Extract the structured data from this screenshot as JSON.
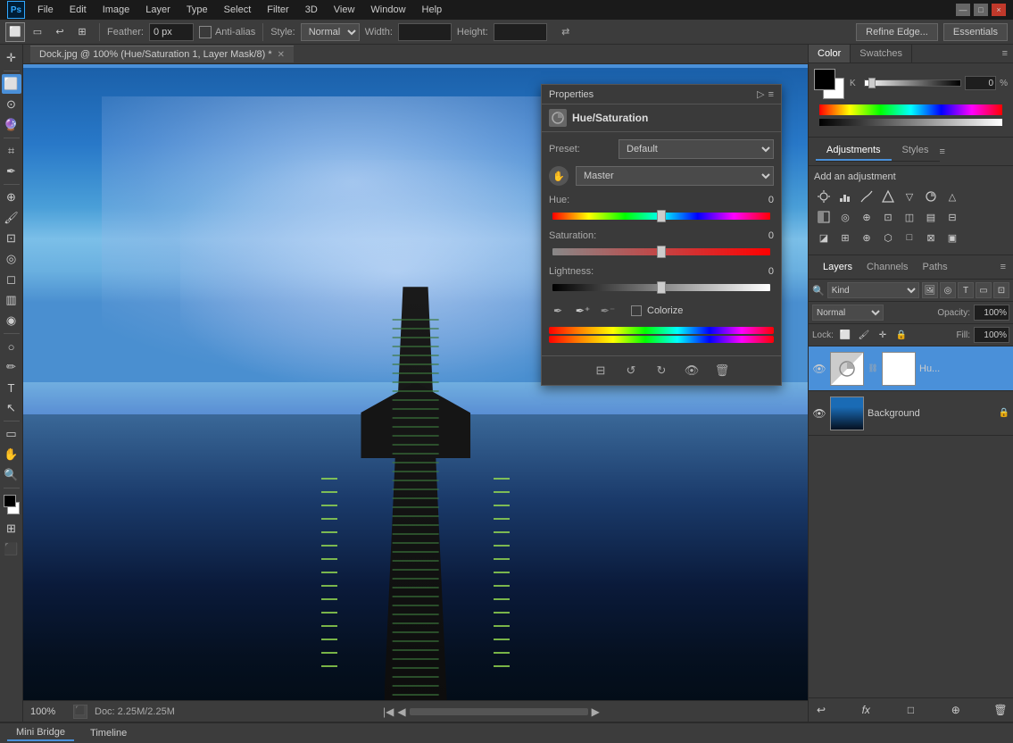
{
  "titlebar": {
    "logo": "Ps",
    "menu_items": [
      "File",
      "Edit",
      "Image",
      "Layer",
      "Type",
      "Select",
      "Filter",
      "3D",
      "View",
      "Window",
      "Help"
    ],
    "win_buttons": [
      "—",
      "□",
      "×"
    ]
  },
  "options_bar": {
    "feather_label": "Feather:",
    "feather_value": "0 px",
    "anti_alias": "Anti-alias",
    "style_label": "Style:",
    "style_value": "Normal",
    "width_label": "Width:",
    "height_label": "Height:",
    "refine_edge": "Refine Edge...",
    "essentials": "Essentials"
  },
  "canvas": {
    "tab_title": "Dock.jpg @ 100% (Hue/Saturation 1, Layer Mask/8) *"
  },
  "properties_panel": {
    "title": "Properties",
    "section_title": "Hue/Saturation",
    "preset_label": "Preset:",
    "preset_value": "Default",
    "channel_label": "Master",
    "hue_label": "Hue:",
    "hue_value": "0",
    "saturation_label": "Saturation:",
    "saturation_value": "0",
    "lightness_label": "Lightness:",
    "lightness_value": "0",
    "colorize_label": "Colorize"
  },
  "color_panel": {
    "color_tab": "Color",
    "swatches_tab": "Swatches",
    "channel_label": "K",
    "channel_value": "0",
    "pct": "%"
  },
  "adjustments_panel": {
    "title": "Adjustments",
    "styles_tab": "Styles",
    "add_adjustment": "Add an adjustment",
    "adj_icons": [
      "☀",
      "▦",
      "◐",
      "◭",
      "▽",
      "△",
      "◈",
      "⊞",
      "≈",
      "⊕",
      "⊡",
      "◫",
      "▤",
      "⊟",
      "◪",
      "⊞",
      "⊕",
      "⬡",
      "□",
      "⊠",
      "▣"
    ]
  },
  "layers_panel": {
    "layers_tab": "Layers",
    "channels_tab": "Channels",
    "paths_tab": "Paths",
    "kind_label": "Kind",
    "blend_mode": "Normal",
    "opacity_label": "Opacity:",
    "opacity_value": "100%",
    "lock_label": "Lock:",
    "fill_label": "Fill:",
    "fill_value": "100%",
    "layers": [
      {
        "name": "Hu...",
        "visible": true,
        "has_mask": true,
        "type": "adjustment"
      },
      {
        "name": "Background",
        "visible": true,
        "has_mask": false,
        "locked": true,
        "type": "image"
      }
    ],
    "bottom_icons": [
      "↩",
      "fx",
      "□",
      "⊕",
      "🗑"
    ]
  },
  "status_bar": {
    "zoom": "100%",
    "doc_info": "Doc: 2.25M/2.25M"
  },
  "bottom_panel": {
    "tabs": [
      "Mini Bridge",
      "Timeline"
    ]
  }
}
